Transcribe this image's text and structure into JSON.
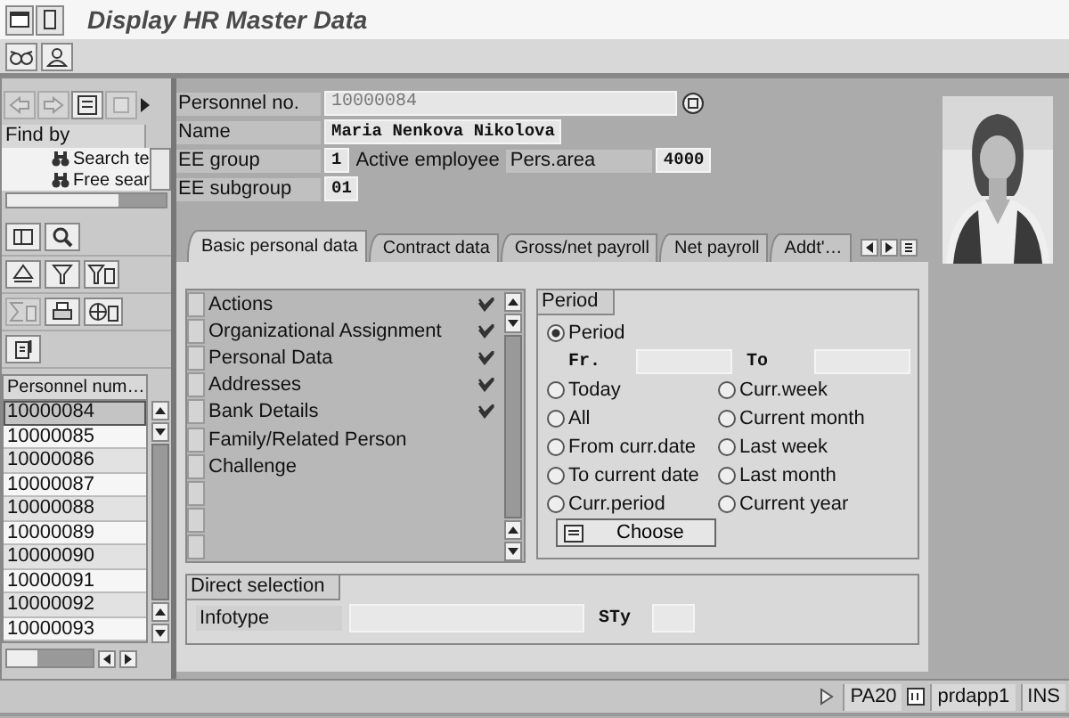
{
  "window": {
    "title": "Display HR Master Data"
  },
  "navigator": {
    "header": "Find by",
    "tree": [
      {
        "label": "Search te"
      },
      {
        "label": "Free sear"
      }
    ],
    "list": {
      "column": "Personnel num…",
      "rows": [
        {
          "value": "10000084",
          "selected": true
        },
        {
          "value": "10000085",
          "selected": false
        },
        {
          "value": "10000086",
          "selected": false
        },
        {
          "value": "10000087",
          "selected": false
        },
        {
          "value": "10000088",
          "selected": false
        },
        {
          "value": "10000089",
          "selected": false
        },
        {
          "value": "10000090",
          "selected": false
        },
        {
          "value": "10000091",
          "selected": false
        },
        {
          "value": "10000092",
          "selected": false
        },
        {
          "value": "10000093",
          "selected": false
        }
      ]
    }
  },
  "header": {
    "personnel_no": {
      "label": "Personnel no.",
      "value": "10000084"
    },
    "name": {
      "label": "Name",
      "value": "Maria Nenkova Nikolova"
    },
    "ee_group": {
      "label": "EE group",
      "value": "1",
      "text": "Active employee"
    },
    "pers_area": {
      "label": "Pers.area",
      "value": "4000"
    },
    "ee_subgroup": {
      "label": "EE subgroup",
      "value": "01"
    }
  },
  "tabs": [
    {
      "label": "Basic personal data",
      "selected": true
    },
    {
      "label": "Contract data",
      "selected": false
    },
    {
      "label": "Gross/net payroll",
      "selected": false
    },
    {
      "label": "Net payroll",
      "selected": false
    },
    {
      "label": "Addt'…",
      "selected": false
    }
  ],
  "infotypes": [
    {
      "label": "Actions",
      "checked": true
    },
    {
      "label": "Organizational Assignment",
      "checked": true
    },
    {
      "label": "Personal Data",
      "checked": true
    },
    {
      "label": "Addresses",
      "checked": true
    },
    {
      "label": "Bank Details",
      "checked": true
    },
    {
      "label": "Family/Related Person",
      "checked": false
    },
    {
      "label": "Challenge",
      "checked": false
    }
  ],
  "period": {
    "title": "Period",
    "from_label": "Fr.",
    "to_label": "To",
    "options": [
      {
        "label": "Period",
        "selected": true
      },
      {
        "label": "Today",
        "selected": false
      },
      {
        "label": "Curr.week",
        "selected": false
      },
      {
        "label": "All",
        "selected": false
      },
      {
        "label": "Current month",
        "selected": false
      },
      {
        "label": "From curr.date",
        "selected": false
      },
      {
        "label": "Last week",
        "selected": false
      },
      {
        "label": "To current date",
        "selected": false
      },
      {
        "label": "Last month",
        "selected": false
      },
      {
        "label": "Curr.period",
        "selected": false
      },
      {
        "label": "Current year",
        "selected": false
      }
    ],
    "button": "Choose"
  },
  "direct_selection": {
    "title": "Direct selection",
    "infotype_label": "Infotype",
    "subtype_label": "STy"
  },
  "status_bar": {
    "transaction": "PA20",
    "server": "prdapp1",
    "mode": "INS"
  }
}
